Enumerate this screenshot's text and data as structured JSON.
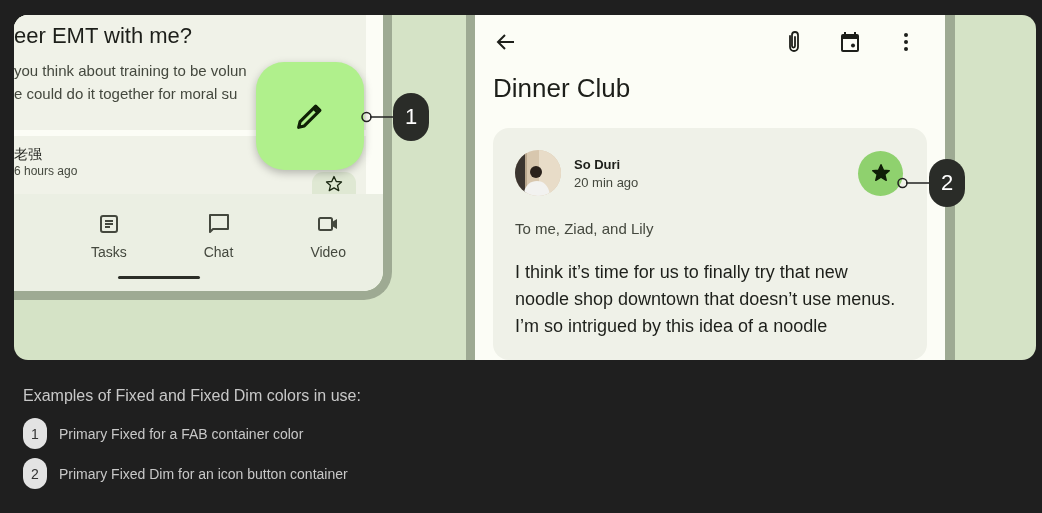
{
  "left_screen": {
    "subject": "eer EMT with me?",
    "preview_lines": [
      "you think about training to be volun",
      "e could do it together for moral su"
    ],
    "sender": "老强",
    "time": "6 hours ago",
    "nav_items": [
      {
        "label": "Tasks"
      },
      {
        "label": "Chat"
      },
      {
        "label": "Video"
      }
    ]
  },
  "right_screen": {
    "title": "Dinner Club",
    "sender": "So Duri",
    "time": "20 min ago",
    "starred": true,
    "recipients": "To me, Ziad, and Lily",
    "body": "I think it’s time for us to finally try that new noodle shop downtown that doesn’t use menus. I’m so intrigued by this idea of a noodle"
  },
  "callouts": [
    {
      "number": "1"
    },
    {
      "number": "2"
    }
  ],
  "caption": {
    "title": "Examples of Fixed and Fixed Dim colors in use:",
    "items": [
      {
        "number": "1",
        "text": "Primary Fixed for a FAB container color"
      },
      {
        "number": "2",
        "text": "Primary Fixed Dim for an icon button container"
      }
    ]
  }
}
